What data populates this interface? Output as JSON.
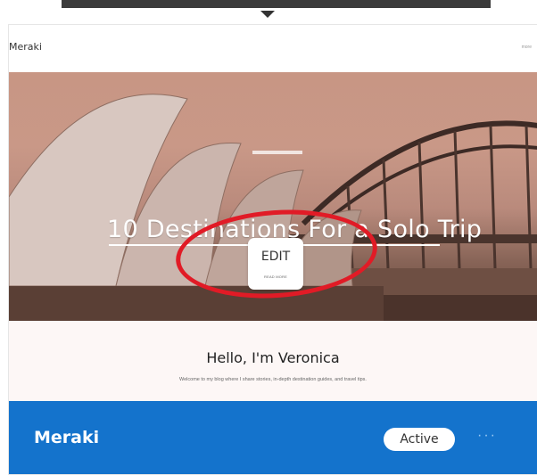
{
  "site": {
    "logo": "Meraki",
    "nav_label": "more"
  },
  "hero": {
    "title": "10 Destinations For a Solo Trip",
    "read_more": "READ MORE"
  },
  "edit": {
    "label": "EDIT"
  },
  "intro": {
    "title": "Hello, I'm Veronica",
    "text": "Welcome to my blog where I share stories, in-depth destination guides, and travel tips."
  },
  "footer": {
    "site_name": "Meraki",
    "status_label": "Active",
    "more_label": "···"
  },
  "colors": {
    "footer_bg": "#1473cc",
    "highlight": "#e11b26"
  },
  "icons": [
    "caret-down-icon",
    "more-options-icon"
  ]
}
